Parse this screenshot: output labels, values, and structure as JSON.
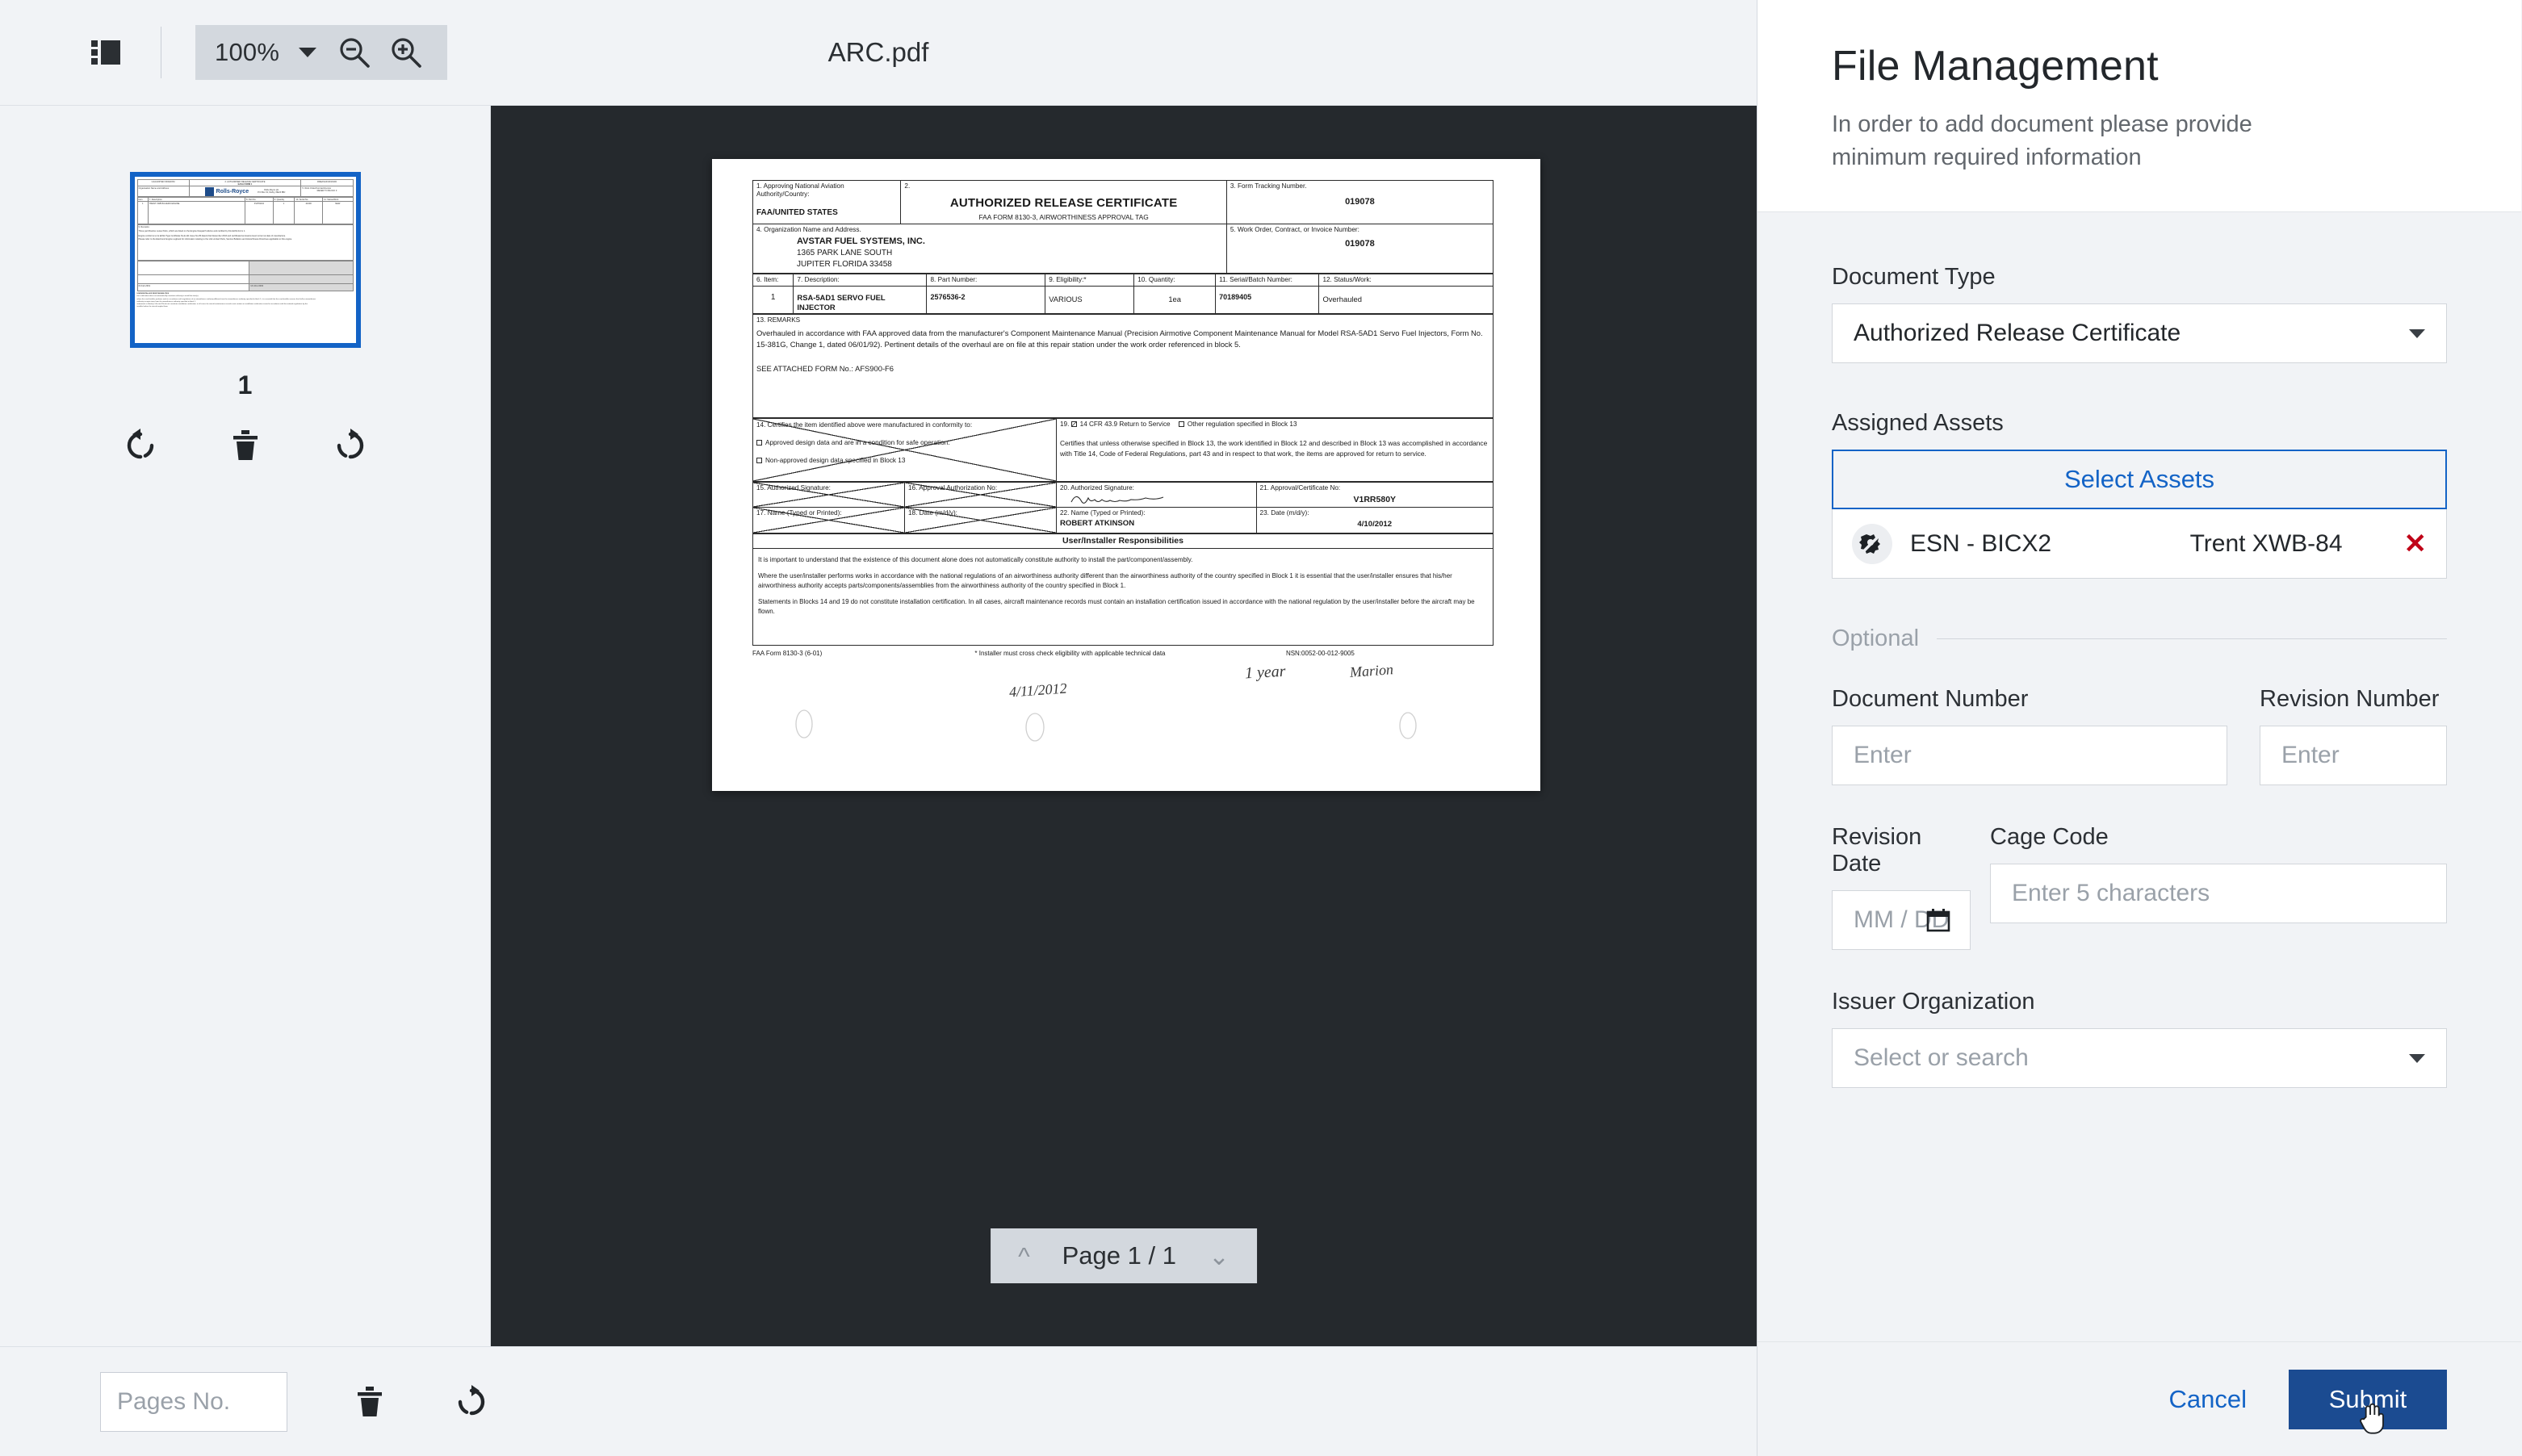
{
  "viewer": {
    "title": "ARC.pdf",
    "toolbar": {
      "thumbnail_toggle_icon": "sidebar-layout-icon",
      "zoom_value": "100%",
      "zoom_out_icon": "zoom-out-icon",
      "zoom_in_icon": "zoom-in-icon"
    },
    "thumbnails": {
      "page_label": "1",
      "rotate_left_icon": "rotate-left-icon",
      "delete_icon": "trash-icon",
      "rotate_right_icon": "rotate-right-icon"
    },
    "pagenav": {
      "up_icon": "chevron-up-icon",
      "label": "Page 1 / 1",
      "down_icon": "chevron-down-icon"
    },
    "footer": {
      "pages_placeholder": "Pages No.",
      "pages_value": "",
      "delete_icon": "trash-icon",
      "rotate_icon": "rotate-right-icon"
    }
  },
  "document": {
    "b1_label": "1.   Approving National Aviation Authority/Country:",
    "b1_value": "FAA/UNITED STATES",
    "b2_num": "2.",
    "b2_title": "AUTHORIZED RELEASE CERTIFICATE",
    "b2_sub": "FAA FORM 8130-3, AIRWORTHINESS APPROVAL TAG",
    "b3_label": "3.   Form Tracking Number.",
    "b3_value": "019078",
    "b4_label": "4.    Organization Name and Address.",
    "b4_org": "AVSTAR FUEL SYSTEMS, INC.",
    "b4_addr1": "1365 PARK LANE SOUTH",
    "b4_addr2": "JUPITER FLORIDA 33458",
    "b5_label": "5.    Work Order, Contract, or Invoice Number:",
    "b5_value": "019078",
    "cols": [
      "6.  Item:",
      "7.      Description:",
      "8.      Part Number:",
      "9.   Eligibility:*",
      "10. Quantity:",
      "11. Serial/Batch Number:",
      "12.    Status/Work:"
    ],
    "row": [
      "1",
      "RSA-5AD1 SERVO FUEL INJECTOR",
      "2576536-2",
      "VARIOUS",
      "1ea",
      "70189405",
      "Overhauled"
    ],
    "b13_label": "13.   REMARKS",
    "b13_p1": "Overhauled in accordance with FAA approved data from the manufacturer's Component Maintenance Manual (Precision Airmotive Component Maintenance Manual for Model RSA-5AD1 Servo Fuel Injectors, Form No. 15-381G, Change 1, dated 06/01/92).  Pertinent details of the overhaul are on file at this repair station under the work order referenced in block 5.",
    "b13_p2": "SEE ATTACHED FORM No.:  AFS900-F6",
    "b14_label": "14.  Certifies the item identified above were manufactured in conformity to:",
    "b14_opt1": "Approved design data and are in a condition for safe operation.",
    "b14_opt2": "Non-approved design data specified in Block 13",
    "b19_label": "19.",
    "b19_opt1": "14 CFR 43.9 Return to Service",
    "b19_opt2": "Other regulation specified in Block 13",
    "b19_text": "Certifies that unless otherwise specified in Block 13, the work identified in Block 12 and described in Block 13 was accomplished in accordance with Title 14, Code of Federal Regulations, part 43 and in respect to that work, the items are approved for return to service.",
    "b15_label": "15.  Authorized Signature:",
    "b16_label": "16.  Approval Authorization No:",
    "b20_label": "20.  Authorized Signature:",
    "b21_label": "21.    Approval/Certificate No:",
    "b21_value": "V1RR580Y",
    "b17_label": "17.  Name (Typed or Printed):",
    "b18_label": "18.   Date (m/d/y):",
    "b22_label": "22.  Name (Typed or Printed):",
    "b22_value": "ROBERT ATKINSON",
    "b23_label": "23.  Date (m/d/y):",
    "b23_value": "4/10/2012",
    "ui_heading": "User/Installer Responsibilities",
    "ui_p1": "It is important to understand that the existence of this document alone does not automatically constitute authority to install the part/component/assembly.",
    "ui_p2": "Where the user/installer performs works in accordance with the national regulations of an airworthiness authority different than the airworthiness authority of the country specified in Block 1 it is essential that the user/installer ensures that his/her airworthiness authority accepts parts/components/assemblies from the airworthiness authority of the country specified in Block 1.",
    "ui_p3": "Statements in Blocks 14 and 19 do not constitute installation certification.  In all cases, aircraft maintenance records must contain an installation certification issued in accordance with the national regulation by the user/installer before the aircraft may be flown.",
    "foot_left": "FAA Form 8130-3   (6-01)",
    "foot_mid": "* Installer must cross check eligibility with applicable technical data",
    "foot_right": "NSN:0052-00-012-9005",
    "hand_date": "4/11/2012",
    "hand_year": "1 year",
    "hand_name": "Marion"
  },
  "thumbnail_doc": {
    "country": "CAA/UNITED KINGDOM",
    "title": "2. AUTHORISED RELEASE CERTIFICATE",
    "subtitle": "EASA FORM 1",
    "tracking": "RREASAF13019193",
    "org_label": "Organisation Name and Address:",
    "brand": "Rolls-Royce",
    "company": "Rolls-Royce plc",
    "company_addr": "P.O.Box 31, Derby, DE24 8BJ",
    "work_order_label": "5. Work Order/Contract/Invoice",
    "work_order": "REFER TO BLOCK 3",
    "cols": [
      "Item",
      "7. Description",
      "8. Part No.",
      "9. Quantity",
      "10. Serial No.",
      "11. Status/Work"
    ],
    "row": [
      "1",
      "TRENT XWB-84 AERO ENGINE",
      "KV879234",
      "1",
      "21000",
      "NEW"
    ],
    "remarks_label": "9. Remarks",
    "remarks1": "Three part Routine Loose Parts, which are listed on the Engine Despatch Advice and certified by this EASA Form 1.",
    "remarks2": "Engine conforms to its EASA Type Certificate No.E.111 Issue No.05 dated 21st December 2016 and certificated emissions level current at date of manufacture.",
    "remarks3": "Please refer to the Electronic Engine Logbook for information relating to the Life Limited Parts, Service Bulletins and Airworthiness Directives applicable to this engine.",
    "sig_date": "04 Feb 2019",
    "auth_no": "UK.21G.0003"
  },
  "panel": {
    "title": "File Management",
    "subtitle": "In order to add document please provide minimum required information",
    "document_type": {
      "label": "Document Type",
      "value": "Authorized Release Certificate",
      "caret_icon": "chevron-down-icon"
    },
    "assigned_assets": {
      "label": "Assigned Assets",
      "select_button": "Select Assets",
      "rows": [
        {
          "icon": "engine-icon",
          "esn": "ESN - BICX2",
          "model": "Trent XWB-84",
          "remove_icon": "close-x-icon"
        }
      ]
    },
    "optional_label": "Optional",
    "document_number": {
      "label": "Document Number",
      "placeholder": "Enter",
      "value": ""
    },
    "revision_number": {
      "label": "Revision Number",
      "placeholder": "Enter",
      "value": ""
    },
    "revision_date": {
      "label": "Revision Date",
      "placeholder": "MM / DD / YYYY",
      "value": "",
      "icon": "calendar-icon"
    },
    "cage_code": {
      "label": "Cage Code",
      "placeholder": "Enter 5 characters",
      "value": ""
    },
    "issuer_organization": {
      "label": "Issuer Organization",
      "placeholder": "Select or search",
      "value": "",
      "caret_icon": "chevron-down-icon"
    },
    "footer": {
      "cancel": "Cancel",
      "submit": "Submit"
    }
  },
  "colors": {
    "accent_blue": "#1363c6",
    "submit_blue": "#1b4b91",
    "remove_red": "#c00418",
    "viewer_dark": "#25292d",
    "chrome_bg": "#f1f3f6",
    "control_bg": "#d3d8de"
  }
}
